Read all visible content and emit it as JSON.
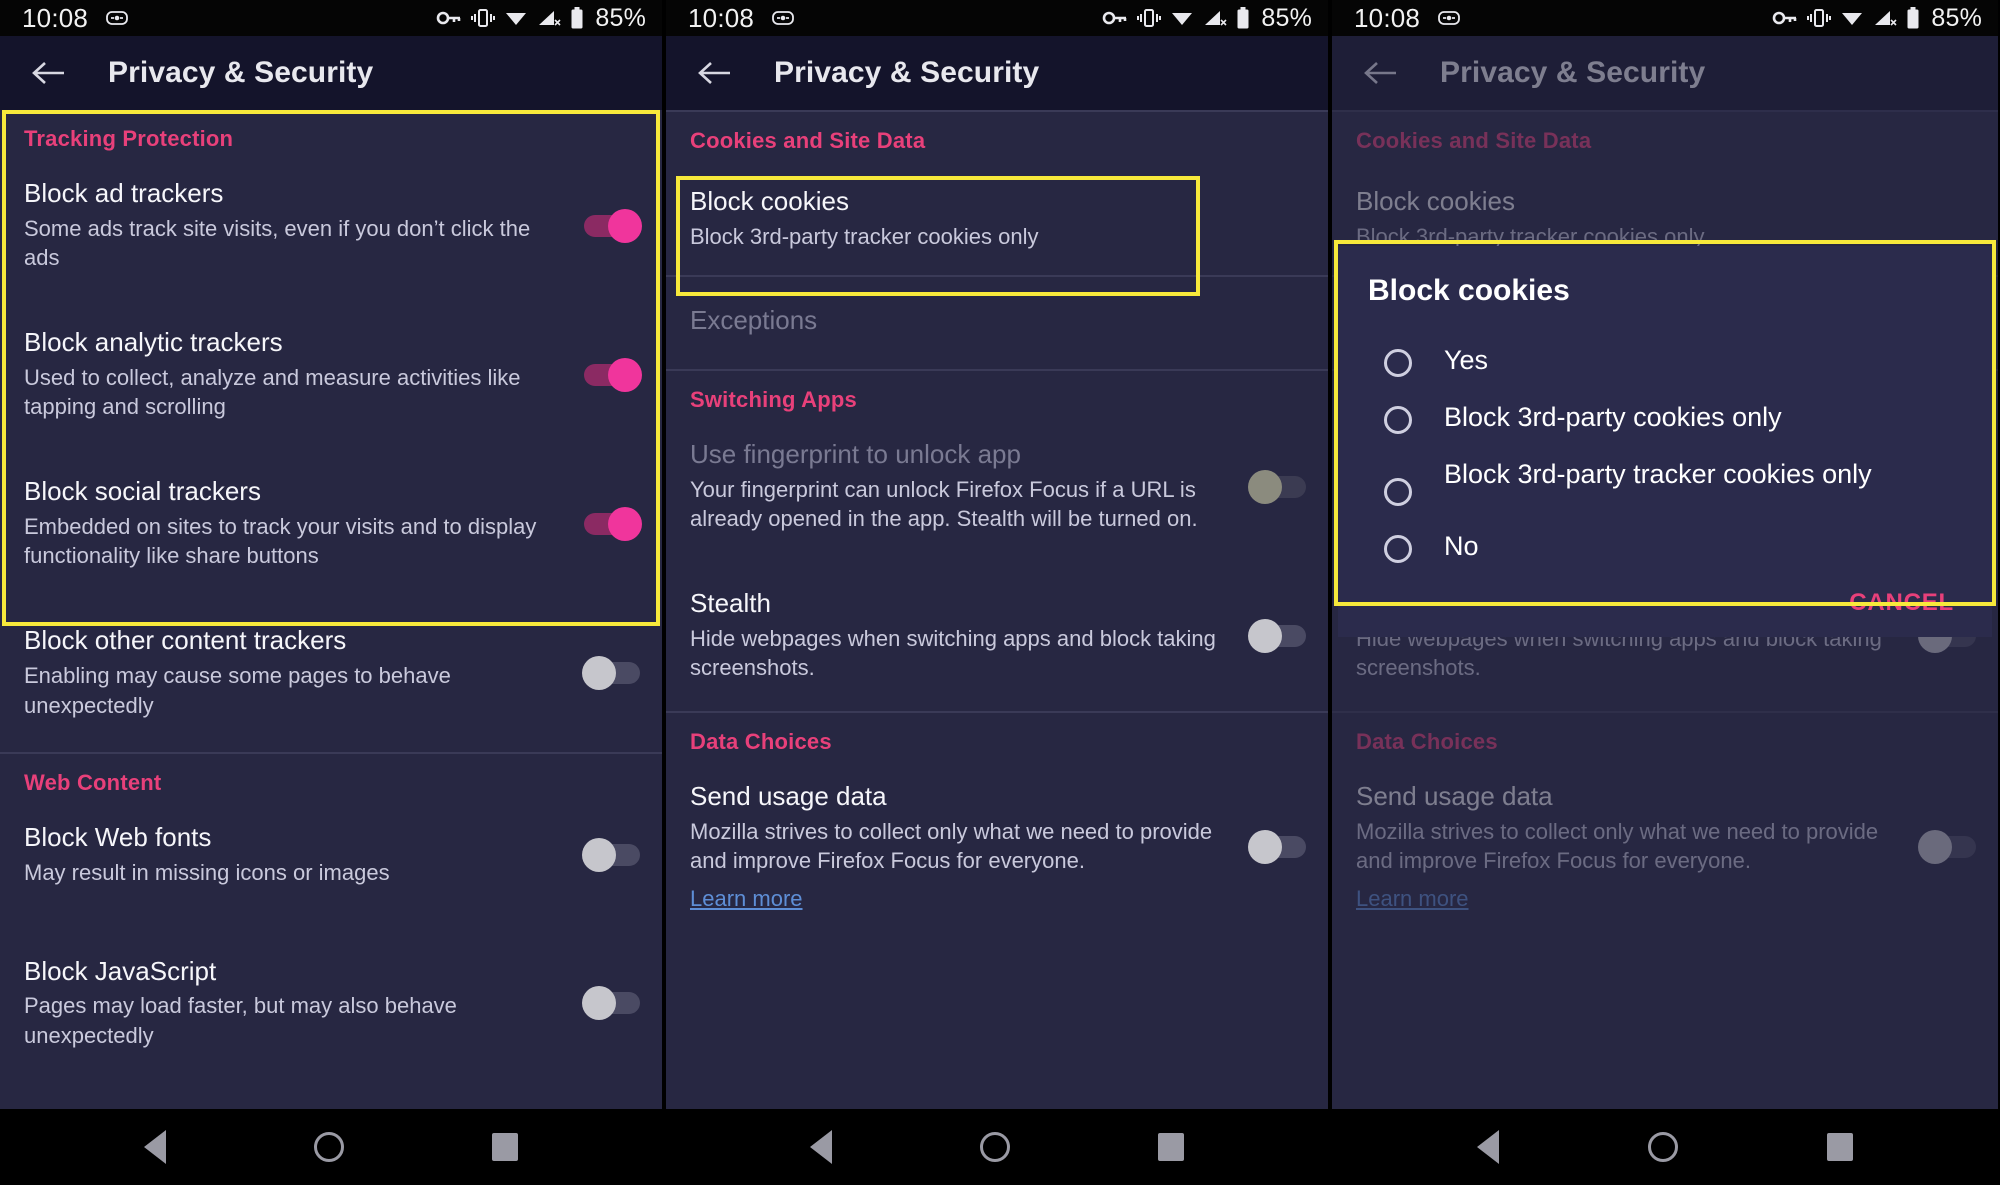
{
  "status_bar": {
    "time": "10:08",
    "battery_percent": "85%",
    "icons": [
      "vibrate-mode-icon",
      "vpn-key-icon",
      "vibrate-icon",
      "wifi-icon",
      "signal-no-service-icon",
      "battery-icon"
    ]
  },
  "app_bar": {
    "title": "Privacy & Security",
    "back_icon": "back-arrow-icon"
  },
  "colors": {
    "accent_pink": "#e8407a",
    "toggle_on": "#f0359c",
    "highlight_yellow": "#f7e93b",
    "surface": "#272742",
    "app_bar": "#14142b",
    "link_blue": "#5e8ed6"
  },
  "nav_bar": {
    "back": "nav-back-icon",
    "home": "nav-home-icon",
    "recents": "nav-recents-icon"
  },
  "screen1": {
    "sections": [
      {
        "heading": "Tracking Protection",
        "rows": [
          {
            "title": "Block ad trackers",
            "subtitle": "Some ads track site visits, even if you don’t click the ads",
            "toggle": "on"
          },
          {
            "title": "Block analytic trackers",
            "subtitle": "Used to collect, analyze and measure activities like tapping and scrolling",
            "toggle": "on"
          },
          {
            "title": "Block social trackers",
            "subtitle": "Embedded on sites to track your visits and to display functionality like share buttons",
            "toggle": "on"
          },
          {
            "title": "Block other content trackers",
            "subtitle": "Enabling may cause some pages to behave unexpectedly",
            "toggle": "off"
          }
        ]
      },
      {
        "heading": "Web Content",
        "rows": [
          {
            "title": "Block Web fonts",
            "subtitle": "May result in missing icons or images",
            "toggle": "off"
          },
          {
            "title": "Block JavaScript",
            "subtitle": "Pages may load faster, but may also behave unexpectedly",
            "toggle": "off"
          }
        ]
      }
    ]
  },
  "screen2": {
    "sections": [
      {
        "heading": "Cookies and Site Data",
        "rows": [
          {
            "title": "Block cookies",
            "subtitle": "Block 3rd-party tracker cookies only",
            "toggle": "none",
            "highlighted": true
          },
          {
            "title": "Exceptions",
            "subtitle": "",
            "toggle": "none",
            "dim": true
          }
        ]
      },
      {
        "heading": "Switching Apps",
        "rows": [
          {
            "title": "Use fingerprint to unlock app",
            "subtitle": "Your fingerprint can unlock Firefox Focus if a URL is already opened in the app. Stealth will be turned on.",
            "toggle": "off",
            "dim_title": true
          },
          {
            "title": "Stealth",
            "subtitle": "Hide webpages when switching apps and block taking screenshots.",
            "toggle": "off"
          }
        ]
      },
      {
        "heading": "Data Choices",
        "rows": [
          {
            "title": "Send usage data",
            "subtitle": "Mozilla strives to collect only what we need to provide and improve Firefox Focus for everyone.",
            "link": "Learn more",
            "toggle": "off"
          }
        ]
      }
    ]
  },
  "screen3": {
    "dialog": {
      "title": "Block cookies",
      "options": [
        {
          "label": "Yes",
          "selected": false
        },
        {
          "label": "Block 3rd-party cookies only",
          "selected": false
        },
        {
          "label": "Block 3rd-party tracker cookies only",
          "selected": false
        },
        {
          "label": "No",
          "selected": false
        }
      ],
      "cancel_label": "CANCEL"
    }
  }
}
